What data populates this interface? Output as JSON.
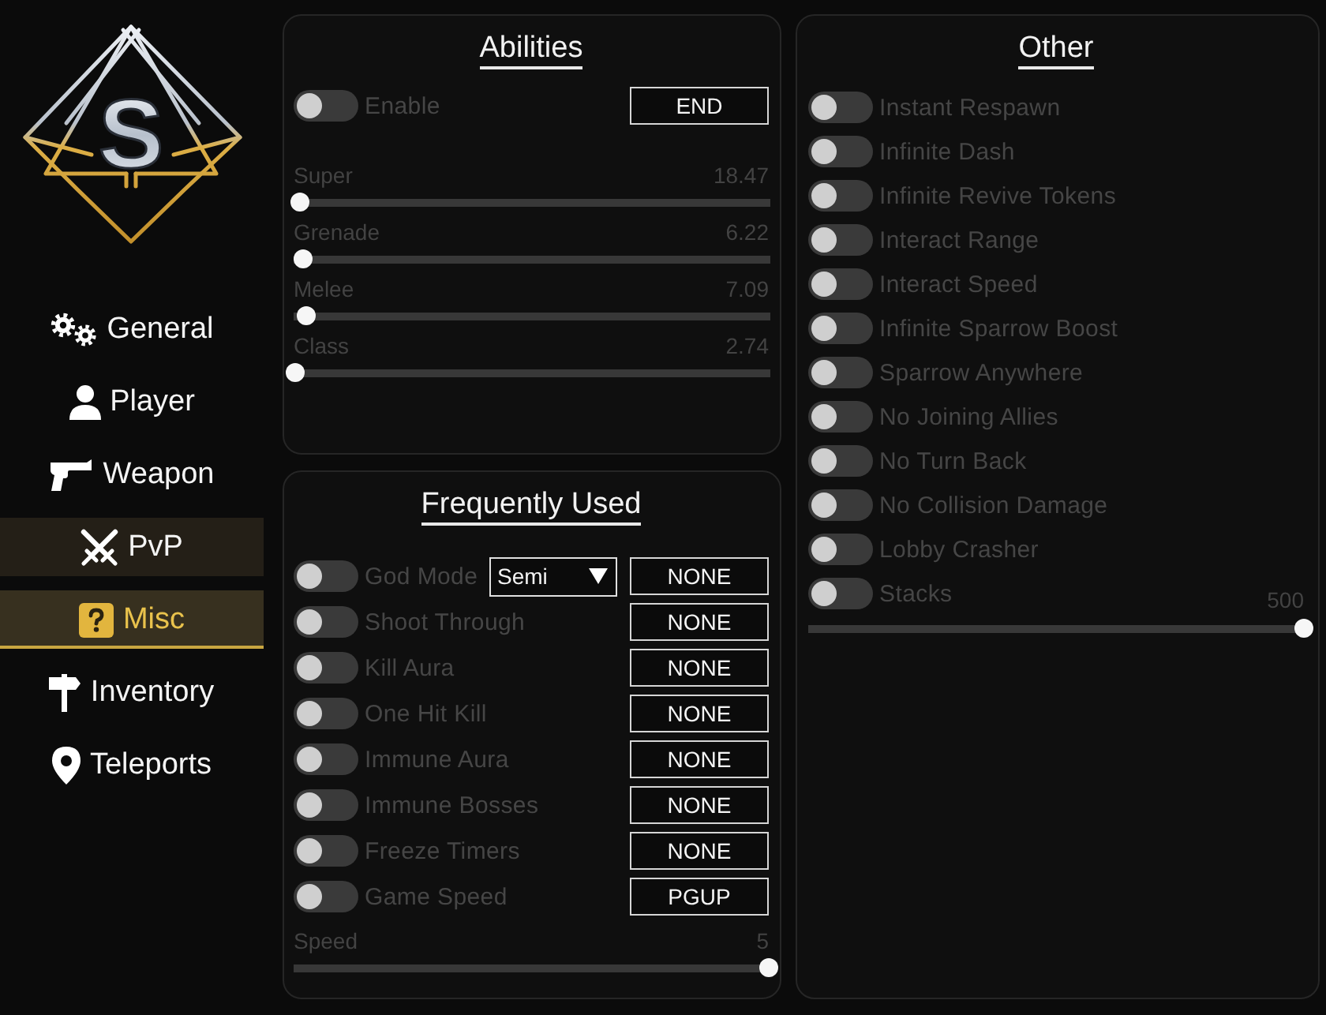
{
  "logo": {
    "letter": "S"
  },
  "nav": [
    {
      "label": "General",
      "selected": false,
      "hovered": false
    },
    {
      "label": "Player",
      "selected": false,
      "hovered": false
    },
    {
      "label": "Weapon",
      "selected": false,
      "hovered": false
    },
    {
      "label": "PvP",
      "selected": false,
      "hovered": true
    },
    {
      "label": "Misc",
      "selected": true,
      "hovered": false
    },
    {
      "label": "Inventory",
      "selected": false,
      "hovered": false
    },
    {
      "label": "Teleports",
      "selected": false,
      "hovered": false
    }
  ],
  "abilities": {
    "title": "Abilities",
    "enable": {
      "label": "Enable",
      "on": false,
      "key": "END"
    },
    "sliders": [
      {
        "label": "Super",
        "value": "18.47",
        "level": 0.01
      },
      {
        "label": "Grenade",
        "value": "6.22",
        "level": 0.017
      },
      {
        "label": "Melee",
        "value": "7.09",
        "level": 0.023
      },
      {
        "label": "Class",
        "value": "2.74",
        "level": 0
      }
    ]
  },
  "frequently_used": {
    "title": "Frequently Used",
    "rows": [
      {
        "label": "God Mode",
        "on": false,
        "mode": "Semi",
        "key": "NONE"
      },
      {
        "label": "Shoot Through",
        "on": false,
        "key": "NONE"
      },
      {
        "label": "Kill Aura",
        "on": false,
        "key": "NONE"
      },
      {
        "label": "One Hit Kill",
        "on": false,
        "key": "NONE"
      },
      {
        "label": "Immune Aura",
        "on": false,
        "key": "NONE"
      },
      {
        "label": "Immune Bosses",
        "on": false,
        "key": "NONE"
      },
      {
        "label": "Freeze Timers",
        "on": false,
        "key": "NONE"
      },
      {
        "label": "Game Speed",
        "on": false,
        "key": "PGUP"
      }
    ],
    "speed": {
      "label": "Speed",
      "value": "5",
      "level": 1
    }
  },
  "other": {
    "title": "Other",
    "rows": [
      {
        "label": "Instant Respawn",
        "on": false
      },
      {
        "label": "Infinite Dash",
        "on": false
      },
      {
        "label": "Infinite Revive Tokens",
        "on": false
      },
      {
        "label": "Interact Range",
        "on": false
      },
      {
        "label": "Interact Speed",
        "on": false
      },
      {
        "label": "Infinite Sparrow Boost",
        "on": false
      },
      {
        "label": "Sparrow Anywhere",
        "on": false
      },
      {
        "label": "No Joining Allies",
        "on": false
      },
      {
        "label": "No Turn Back",
        "on": false
      },
      {
        "label": "No Collision Damage",
        "on": false
      },
      {
        "label": "Lobby Crasher",
        "on": false
      },
      {
        "label": "Stacks",
        "on": false,
        "slider": {
          "value": "500",
          "level": 1
        }
      }
    ]
  }
}
